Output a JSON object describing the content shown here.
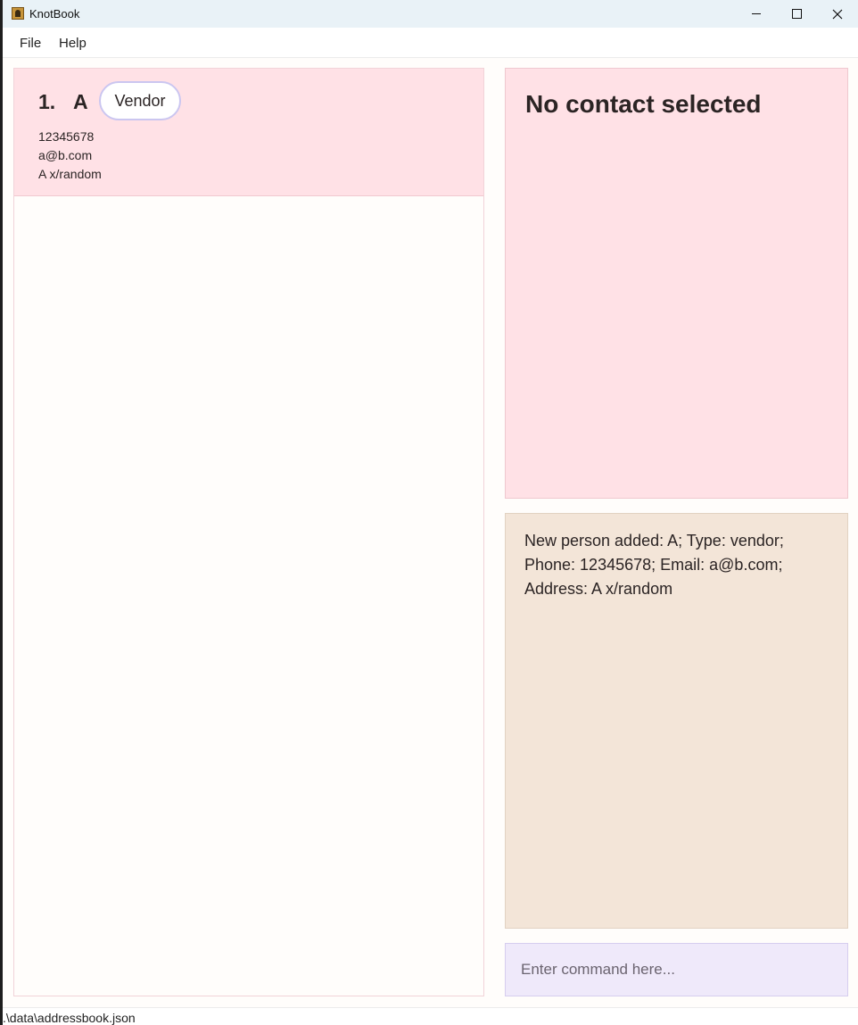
{
  "window": {
    "title": "KnotBook",
    "icon": "contact-book-icon",
    "controls": [
      "minimize-icon",
      "maximize-icon",
      "close-icon"
    ]
  },
  "menu": {
    "file_label": "File",
    "help_label": "Help"
  },
  "person_list": [
    {
      "index": "1.",
      "name": "A",
      "tag": "Vendor",
      "phone": "12345678",
      "email": "a@b.com",
      "address": "A x/random"
    }
  ],
  "detail": {
    "title": "No contact selected"
  },
  "result": {
    "message": "New person added: A; Type: vendor;\nPhone: 12345678; Email: a@b.com;\nAddress: A x/random"
  },
  "command": {
    "value": "",
    "placeholder": "Enter command here..."
  },
  "status": {
    "path": ".\\data\\addressbook.json"
  },
  "colors": {
    "card_bg": "#ffe1e6",
    "result_bg": "#f3e5d8",
    "command_bg": "#efe9fa",
    "tag_border": "#cbc6f0",
    "text": "#2b2424"
  }
}
